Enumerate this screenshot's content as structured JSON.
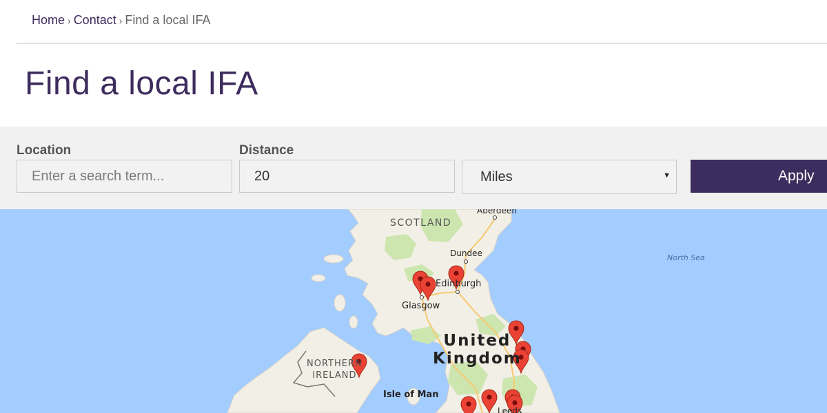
{
  "breadcrumb": {
    "home": "Home",
    "separator": "›",
    "contact": "Contact",
    "current": "Find a local IFA"
  },
  "page": {
    "title": "Find a local IFA"
  },
  "filters": {
    "location_label": "Location",
    "location_placeholder": "Enter a search term...",
    "location_value": "",
    "distance_label": "Distance",
    "distance_value": "20",
    "unit_value": "Miles",
    "apply_label": "Apply"
  },
  "map": {
    "labels": {
      "scotland": "SCOTLAND",
      "aberdeen": "Aberdeen",
      "dundee": "Dundee",
      "edinburgh": "Edinburgh",
      "glasgow": "Glasgow",
      "uk_line1": "United",
      "uk_line2": "Kingdom",
      "ni_line1": "NORTHERN",
      "ni_line2": "IRELAND",
      "isle_of_man": "Isle of Man",
      "north_sea": "North Sea",
      "leeds": "Leeds"
    },
    "marker_icon": "map-marker-icon",
    "colors": {
      "water": "#a3ccff",
      "land": "#f2efe6",
      "park": "#cde6b0",
      "marker": "#ea4335"
    }
  },
  "colors": {
    "brand": "#3d2c5e",
    "filter_bg": "#f1f1f1"
  }
}
